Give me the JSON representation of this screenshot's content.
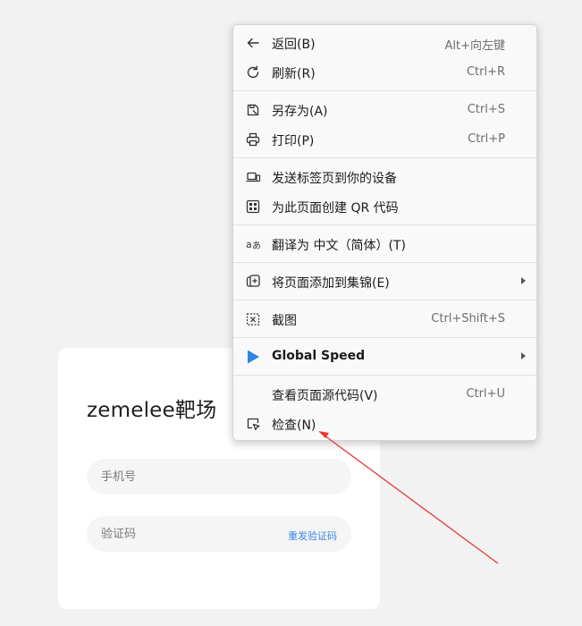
{
  "card": {
    "title": "zemelee靶场",
    "phone_placeholder": "手机号",
    "code_placeholder": "验证码",
    "resend_label": "重发验证码",
    "accent_color": "#3d87e6"
  },
  "menu": {
    "items": [
      {
        "label": "返回(B)",
        "shortcut": "Alt+向左键",
        "icon": "back-arrow-icon"
      },
      {
        "label": "刷新(R)",
        "shortcut": "Ctrl+R",
        "icon": "refresh-icon"
      },
      {
        "label": "另存为(A)",
        "shortcut": "Ctrl+S",
        "icon": "save-icon"
      },
      {
        "label": "打印(P)",
        "shortcut": "Ctrl+P",
        "icon": "print-icon"
      },
      {
        "label": "发送标签页到你的设备",
        "shortcut": "",
        "icon": "send-device-icon"
      },
      {
        "label": "为此页面创建 QR 代码",
        "shortcut": "",
        "icon": "qr-code-icon"
      },
      {
        "label": "翻译为 中文（简体）(T)",
        "shortcut": "",
        "icon": "translate-icon"
      },
      {
        "label": "将页面添加到集锦(E)",
        "shortcut": "",
        "icon": "collections-icon"
      },
      {
        "label": "截图",
        "shortcut": "Ctrl+Shift+S",
        "icon": "screenshot-icon"
      },
      {
        "label": "Global Speed",
        "shortcut": "",
        "icon": "play-icon"
      },
      {
        "label": "查看页面源代码(V)",
        "shortcut": "Ctrl+U",
        "icon": ""
      },
      {
        "label": "检查(N)",
        "shortcut": "",
        "icon": "inspect-icon"
      }
    ],
    "play_icon_color": "#2f86e0"
  },
  "annotation": {
    "arrow_color": "#e53935"
  }
}
